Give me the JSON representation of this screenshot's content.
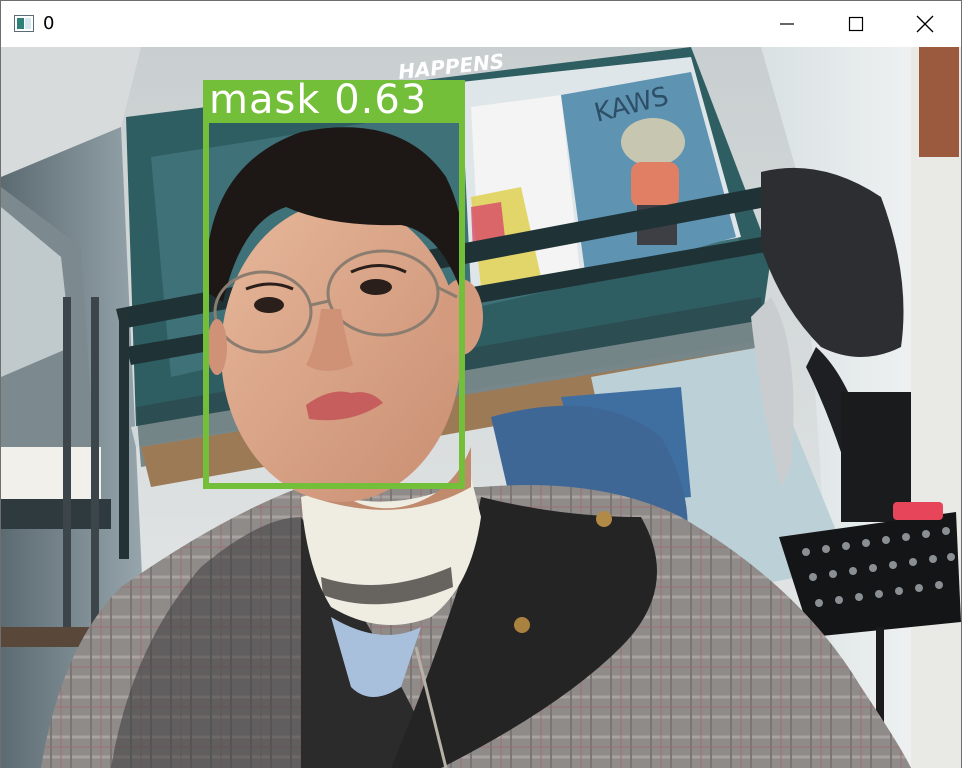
{
  "window": {
    "title": "0",
    "icons": {
      "app": "opencv-window-icon",
      "minimize": "minimize-icon",
      "maximize": "maximize-icon",
      "close": "close-icon"
    }
  },
  "detection": {
    "label": "mask 0.63",
    "color": "#74bf3a"
  },
  "scene": {
    "poster_text": "HAPPENS",
    "figure_text": "KAWS"
  }
}
